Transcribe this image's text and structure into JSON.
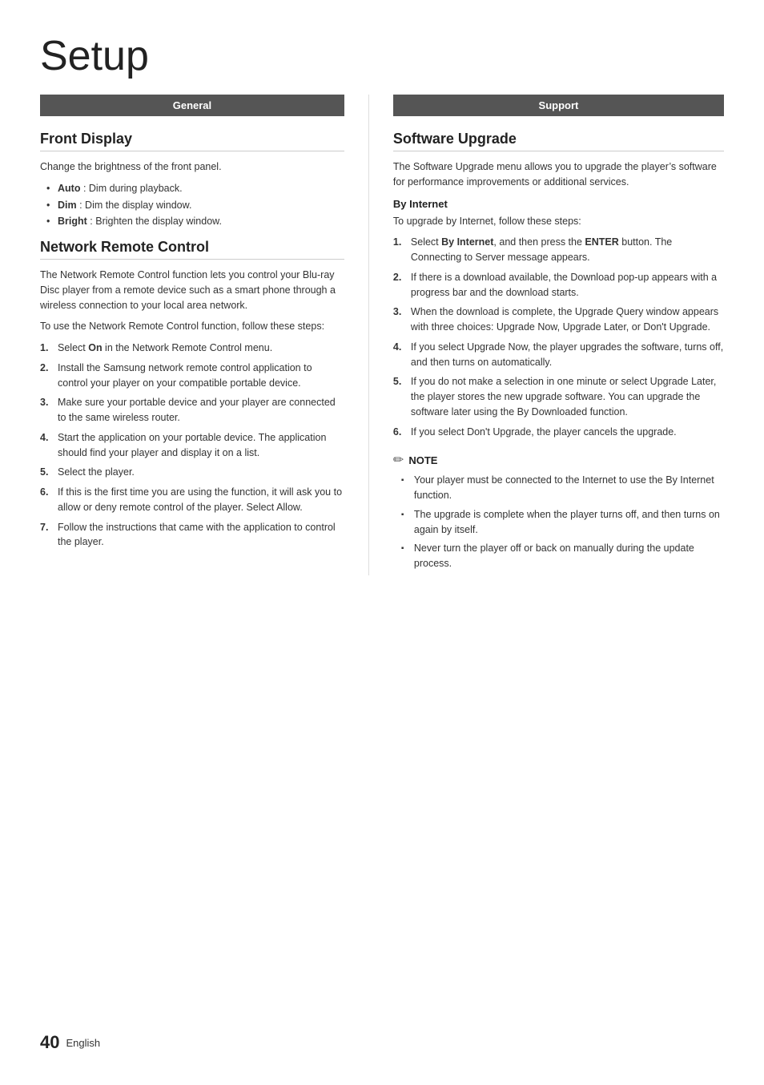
{
  "page": {
    "title": "Setup",
    "footer": {
      "page_number": "40",
      "language": "English"
    }
  },
  "left_column": {
    "header": "General",
    "sections": [
      {
        "id": "front-display",
        "title": "Front Display",
        "intro": "Change the brightness of the front panel.",
        "bullets": [
          {
            "bold": "Auto",
            "text": " : Dim during playback."
          },
          {
            "bold": "Dim",
            "text": " : Dim the display window."
          },
          {
            "bold": "Bright",
            "text": " : Brighten the display window."
          }
        ]
      },
      {
        "id": "network-remote-control",
        "title": "Network Remote Control",
        "intro": "The Network Remote Control function lets you control your Blu-ray Disc player from a remote device such as a smart phone through a wireless connection to your local area network.",
        "intro2": "To use the Network Remote Control function, follow these steps:",
        "steps": [
          "Select On in the Network Remote Control menu.",
          "Install the Samsung network remote control application to control your player on your compatible portable device.",
          "Make sure your portable device and your player are connected to the same wireless router.",
          "Start the application on your portable device. The application should find your player and display it on a list.",
          "Select the player.",
          "If this is the first time you are using the function, it will ask you to allow or deny remote control of the player. Select Allow.",
          "Follow the instructions that came with the application to control the player."
        ],
        "steps_bold": [
          "On",
          "",
          "",
          "",
          "",
          "",
          ""
        ]
      }
    ]
  },
  "right_column": {
    "header": "Support",
    "sections": [
      {
        "id": "software-upgrade",
        "title": "Software Upgrade",
        "intro": "The Software Upgrade menu allows you to upgrade the player’s software for performance improvements or additional services.",
        "subsections": [
          {
            "title": "By Internet",
            "intro": "To upgrade by Internet, follow these steps:",
            "steps": [
              {
                "text": "Select By Internet, and then press the ENTER button. The Connecting to Server message appears.",
                "bold_parts": [
                  "By Internet",
                  "ENTER"
                ]
              },
              {
                "text": "If there is a download available, the Download pop-up appears with a progress bar and the download starts.",
                "bold_parts": []
              },
              {
                "text": "When the download is complete, the Upgrade Query window appears with three choices: Upgrade Now, Upgrade Later, or Don’t Upgrade.",
                "bold_parts": []
              },
              {
                "text": "If you select Upgrade Now, the player upgrades the software, turns off, and then turns on automatically.",
                "bold_parts": []
              },
              {
                "text": "If you do not make a selection in one minute or select Upgrade Later, the player stores the new upgrade software. You can upgrade the software later using the By Downloaded function.",
                "bold_parts": []
              },
              {
                "text": "If you select Don’t Upgrade, the player cancels the upgrade.",
                "bold_parts": []
              }
            ],
            "note": {
              "label": "NOTE",
              "items": [
                "Your player must be connected to the Internet to use the By Internet function.",
                "The upgrade is complete when the player turns off, and then turns on again by itself.",
                "Never turn the player off or back on manually during the update process."
              ]
            }
          }
        ]
      }
    ]
  }
}
